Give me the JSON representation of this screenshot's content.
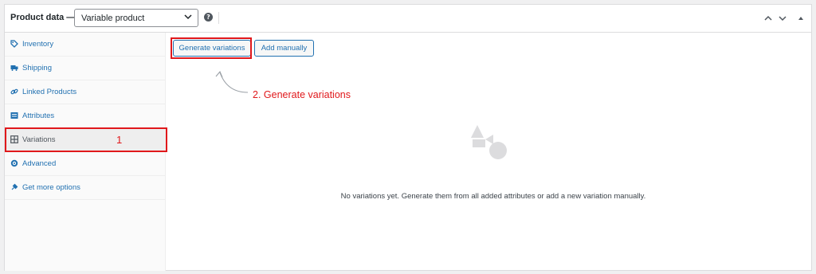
{
  "header": {
    "title": "Product data —",
    "product_type": "Variable product"
  },
  "sidebar": {
    "items": [
      {
        "label": "Inventory",
        "icon": "tag-icon"
      },
      {
        "label": "Shipping",
        "icon": "truck-icon"
      },
      {
        "label": "Linked Products",
        "icon": "link-icon"
      },
      {
        "label": "Attributes",
        "icon": "list-icon"
      },
      {
        "label": "Variations",
        "icon": "grid-icon",
        "active": true
      },
      {
        "label": "Advanced",
        "icon": "gear-icon"
      },
      {
        "label": "Get more options",
        "icon": "plugin-icon"
      }
    ]
  },
  "annotations": {
    "step1": "1",
    "step2": "2. Generate variations"
  },
  "main": {
    "generate_label": "Generate variations",
    "add_manually_label": "Add manually",
    "empty_message": "No variations yet. Generate them from all added attributes or add a new variation manually."
  },
  "colors": {
    "link": "#2271b1",
    "annotation_red": "#e0181b",
    "border": "#dcdcde"
  }
}
